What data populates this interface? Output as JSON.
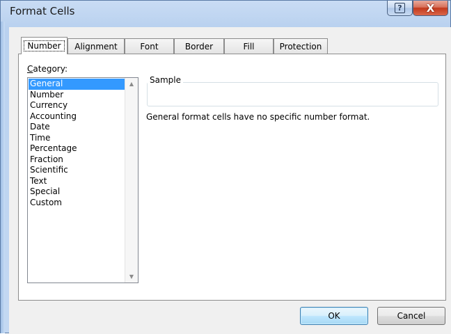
{
  "window": {
    "title": "Format Cells",
    "help_symbol": "?",
    "close_symbol": "X"
  },
  "tabs": [
    {
      "label": "Number",
      "active": true
    },
    {
      "label": "Alignment"
    },
    {
      "label": "Font"
    },
    {
      "label": "Border"
    },
    {
      "label": "Fill"
    },
    {
      "label": "Protection"
    }
  ],
  "category": {
    "label_access_key": "C",
    "label_rest": "ategory:",
    "items": [
      "General",
      "Number",
      "Currency",
      "Accounting",
      "Date",
      "Time",
      "Percentage",
      "Fraction",
      "Scientific",
      "Text",
      "Special",
      "Custom"
    ],
    "selected": "General"
  },
  "sample": {
    "legend": "Sample",
    "value": ""
  },
  "description": "General format cells have no specific number format.",
  "buttons": {
    "ok": "OK",
    "cancel": "Cancel"
  },
  "colors": {
    "selection": "#3399ff",
    "titlebar": "#c3d8f2",
    "close": "#c2391c"
  }
}
